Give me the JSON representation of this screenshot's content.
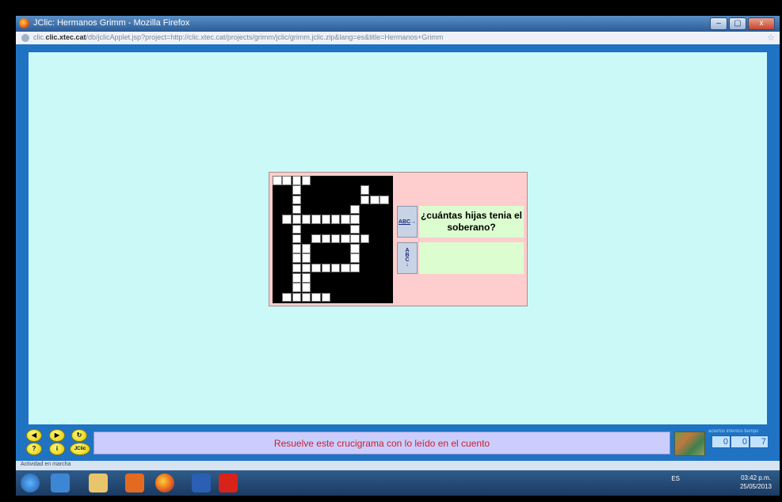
{
  "window": {
    "title": "JClic: Hermanos Grimm - Mozilla Firefox",
    "url_host": "clic.xtec.cat",
    "url_path": "/db/jclicApplet.jsp?project=http://clic.xtec.cat/projects/grimm/jclic/grimm.jclic.zip&lang=es&title=Hermanos+Grimm",
    "url_prefix": "clic.",
    "minimize": "–",
    "maximize": "▢",
    "close": "x"
  },
  "crossword": {
    "across_btn_label": "ABC",
    "down_btn_label": "A B C",
    "across_clue": "¿cuántas hijas tenia el soberano?",
    "down_clue": ""
  },
  "controls": {
    "prev": "◀",
    "next": "▶",
    "restart": "↻",
    "help": "?",
    "info": "i",
    "jclic": "JClic"
  },
  "message": "Resuelve este crucigrama con lo leído en el cuento",
  "counters": {
    "labels": "aciertos intentos tiempo",
    "aciertos": "0",
    "intentos": "0",
    "tiempo": "7"
  },
  "status": "Actividad en marcha",
  "taskbar": {
    "lang": "ES",
    "time": "03:42 p.m.",
    "date": "25/05/2013"
  },
  "colors": {
    "stage": "#cbf9f8",
    "panel": "#fecdcd",
    "clue_box": "#dcfdd0",
    "message_bg": "#cbcdfc",
    "message_text": "#c8222e"
  }
}
